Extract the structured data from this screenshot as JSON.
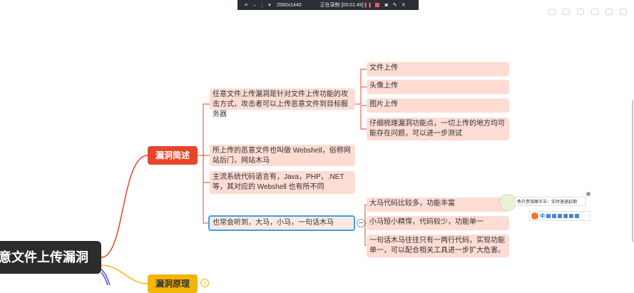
{
  "recorder": {
    "resolution": "2560x1440",
    "status": "正在录制 [00:01:49]"
  },
  "colors": {
    "root": "#2c2c2c",
    "branch_red": "#e6462a",
    "branch_yellow": "#f5b40a",
    "leaf": "#fddcd4",
    "link_red": "#e6462a",
    "selection": "#3ba0e6"
  },
  "mindmap": {
    "root": "意文件上传漏洞",
    "branches": {
      "overview": "漏洞简述",
      "principle": "漏洞原理",
      "principle_badge": "5"
    },
    "overview_children": {
      "definition": "任意文件上传漏洞是针对文件上传功能的攻击方式，攻击者可以上传恶意文件到目标服务器",
      "webshell": "所上传的恶意文件也叫做 Webshell，俗称网站后门，网站木马",
      "languages": "主流系统代码语言有，Java，PHP，.NET 等，其对应的 Webshell 也有所不同",
      "horses": "也常会听到，大马，小马，一句话木马"
    },
    "definition_children": {
      "file_upload": "文件上传",
      "avatar_upload": "头像上传",
      "image_upload": "图片上传",
      "review": "仔细梳理漏洞功能点，一切上传的地方均可能存在问题，可以进一步测试"
    },
    "horses_children": {
      "big": "大马代码比较多，功能丰富",
      "small": "小马短小精悍，代码较少，功能单一",
      "one_line": "一句话木马往往只有一两行代码，实现功能单一，可以配合相关工具进一步扩大危害。"
    }
  },
  "ime": {
    "hint": "秀只贵钱嘛半羊：实时速递延期",
    "lang": "中"
  }
}
